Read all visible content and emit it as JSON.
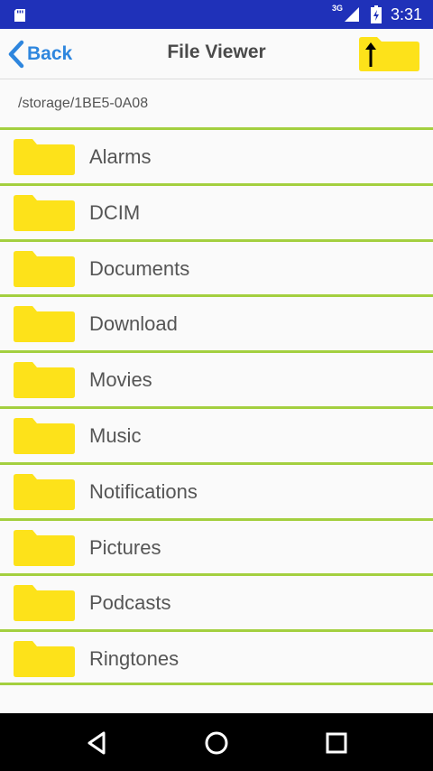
{
  "status_bar": {
    "network": "3G",
    "time": "3:31",
    "icons": [
      "sd-card-icon",
      "signal-icon",
      "battery-charging-icon"
    ]
  },
  "header": {
    "back_label": "Back",
    "title": "File Viewer",
    "up_icon": "folder-up-icon"
  },
  "path": "/storage/1BE5-0A08",
  "folders": [
    {
      "name": "Alarms"
    },
    {
      "name": "DCIM"
    },
    {
      "name": "Documents"
    },
    {
      "name": "Download"
    },
    {
      "name": "Movies"
    },
    {
      "name": "Music"
    },
    {
      "name": "Notifications"
    },
    {
      "name": "Pictures"
    },
    {
      "name": "Podcasts"
    },
    {
      "name": "Ringtones"
    }
  ],
  "nav_bar": {
    "icons": [
      "nav-back-icon",
      "nav-home-icon",
      "nav-recent-icon"
    ]
  },
  "colors": {
    "status_bar": "#1f31b9",
    "accent": "#2e86de",
    "divider": "#a3cf3f",
    "folder": "#fde21a"
  }
}
